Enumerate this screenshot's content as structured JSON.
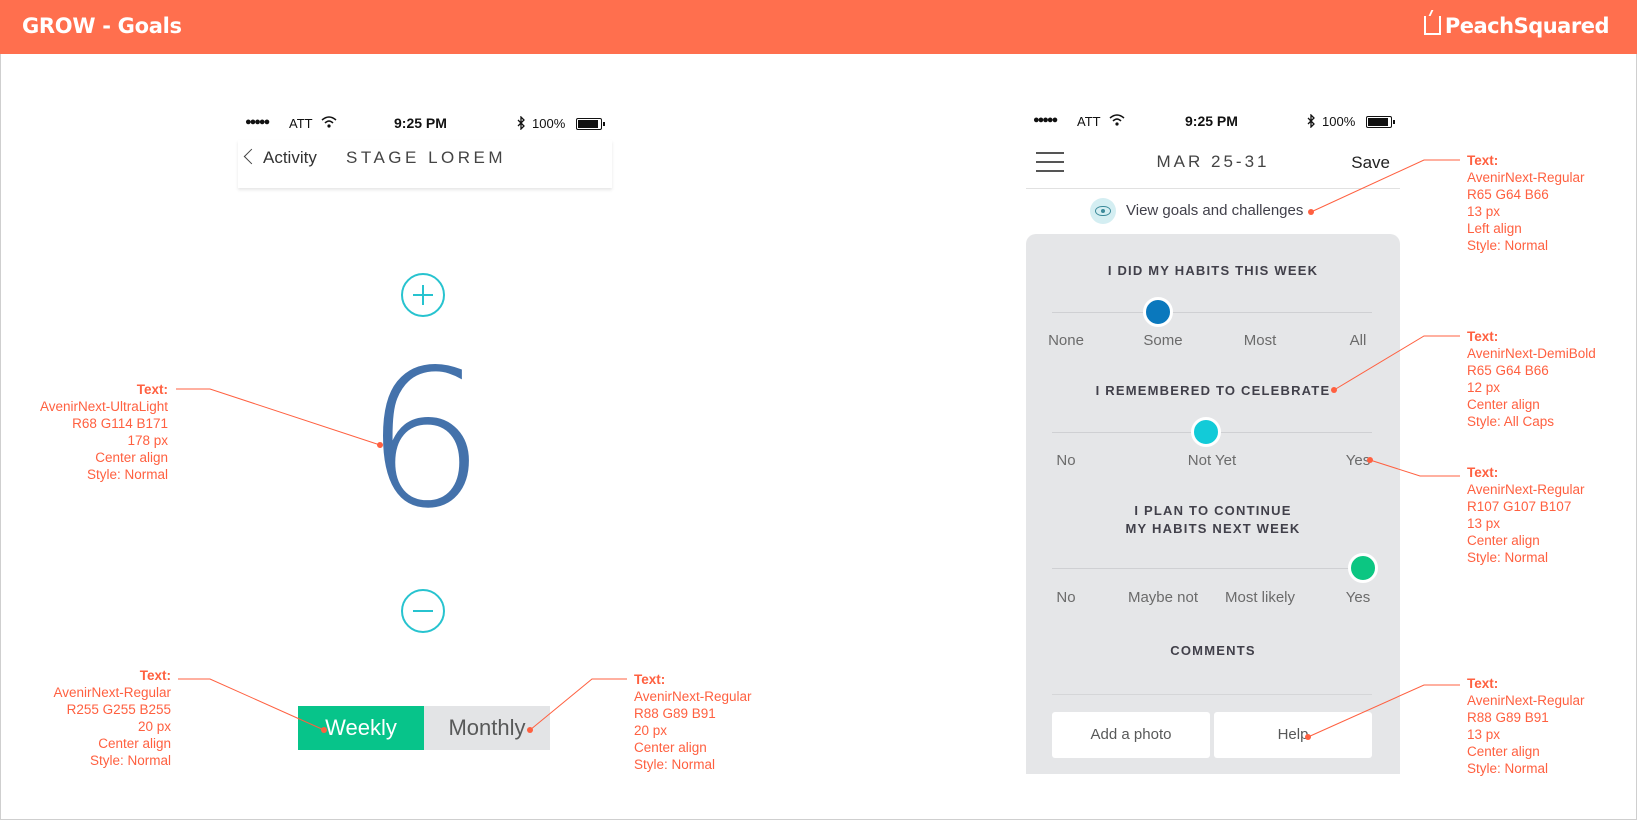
{
  "header": {
    "title": "GROW - Goals",
    "brand": "PeachSquared"
  },
  "left_phone": {
    "status": {
      "dots": "●●●●●",
      "carrier": "ATT",
      "time": "9:25 PM",
      "battery": "100%"
    },
    "nav": {
      "back_label": "Activity",
      "title": "STAGE LOREM"
    },
    "counter_value": "6",
    "toggle": {
      "weekly": "Weekly",
      "monthly": "Monthly"
    }
  },
  "right_phone": {
    "status": {
      "dots": "●●●●●",
      "carrier": "ATT",
      "time": "9:25 PM",
      "battery": "100%"
    },
    "nav": {
      "title": "MAR 25-31",
      "save": "Save"
    },
    "view_goals": "View goals and challenges",
    "questions": [
      {
        "label": "I DID MY HABITS THIS WEEK",
        "options": [
          "None",
          "Some",
          "Most",
          "All"
        ],
        "selected": "Some",
        "color": "#0a78bd"
      },
      {
        "label": "I REMEMBERED TO CELEBRATE",
        "options": [
          "No",
          "Not Yet",
          "Yes"
        ],
        "selected": "Not Yet",
        "color": "#12cbd8"
      },
      {
        "label_line1": "I PLAN TO CONTINUE",
        "label_line2": "MY HABITS NEXT WEEK",
        "options": [
          "No",
          "Maybe not",
          "Most likely",
          "Yes"
        ],
        "selected": "Yes",
        "color": "#0cc682"
      }
    ],
    "comments_label": "COMMENTS",
    "add_photo": "Add a photo",
    "help": "Help"
  },
  "annotations": {
    "big_number": [
      "Text:",
      "AvenirNext-UltraLight",
      "R68 G114 B171",
      "178 px",
      "Center align",
      "Style: Normal"
    ],
    "weekly": [
      "Text:",
      "AvenirNext-Regular",
      "R255 G255 B255",
      "20 px",
      "Center align",
      "Style: Normal"
    ],
    "monthly": [
      "Text:",
      "AvenirNext-Regular",
      "R88 G89 B91",
      "20 px",
      "Center align",
      "Style: Normal"
    ],
    "view_goals": [
      "Text:",
      "AvenirNext-Regular",
      "R65 G64 B66",
      "13 px",
      "Left align",
      "Style: Normal"
    ],
    "celebrate": [
      "Text:",
      "AvenirNext-DemiBold",
      "R65 G64 B66",
      "12 px",
      "Center align",
      "Style: All Caps"
    ],
    "yes": [
      "Text:",
      "AvenirNext-Regular",
      "R107 G107 B107",
      "13 px",
      "Center align",
      "Style: Normal"
    ],
    "help": [
      "Text:",
      "AvenirNext-Regular",
      "R88 G89 B91",
      "13 px",
      "Center align",
      "Style: Normal"
    ]
  },
  "colors": {
    "header": "#ff6f4e",
    "accent_teal": "#27c3cf",
    "number": "#4472ab",
    "weekly_green": "#07c48a",
    "annotation": "#ff6040"
  }
}
